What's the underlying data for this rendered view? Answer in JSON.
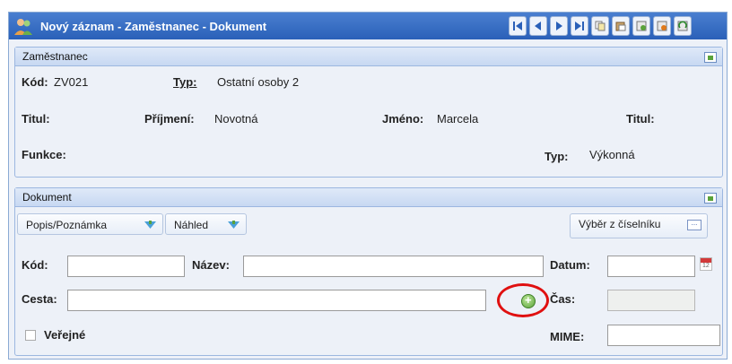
{
  "window": {
    "title": "Nový záznam - Zaměstnanec - Dokument"
  },
  "toolbar": {
    "icons": [
      "first-record-icon",
      "previous-record-icon",
      "next-record-icon",
      "last-record-icon",
      "copy-icon",
      "paste-icon",
      "save-icon",
      "save-close-icon",
      "refresh-icon"
    ]
  },
  "employee": {
    "title": "Zaměstnanec",
    "kod_label": "Kód:",
    "kod_value": "ZV021",
    "typ_label": "Typ:",
    "typ_value": "Ostatní osoby 2",
    "titul_label": "Titul:",
    "prijmeni_label": "Příjmení:",
    "prijmeni_value": "Novotná",
    "jmeno_label": "Jméno:",
    "jmeno_value": "Marcela",
    "titul2_label": "Titul:",
    "funkce_label": "Funkce:",
    "typ2_label": "Typ:",
    "typ2_value": "Výkonná"
  },
  "document": {
    "title": "Dokument",
    "tabs": [
      "Popis/Poznámka",
      "Náhled"
    ],
    "select_button": "Výběr z číselníku",
    "kod_label": "Kód:",
    "kod_value": "",
    "nazev_label": "Název:",
    "nazev_value": "",
    "datum_label": "Datum:",
    "datum_value": "",
    "cesta_label": "Cesta:",
    "cesta_value": "",
    "cas_label": "Čas:",
    "cas_value": "",
    "verejne_label": "Veřejné",
    "mime_label": "MIME:",
    "mime_value": ""
  },
  "colors": {
    "titlebar": "#2a60b8",
    "highlight_circle": "#e01010",
    "add_icon": "#5aa33a"
  }
}
